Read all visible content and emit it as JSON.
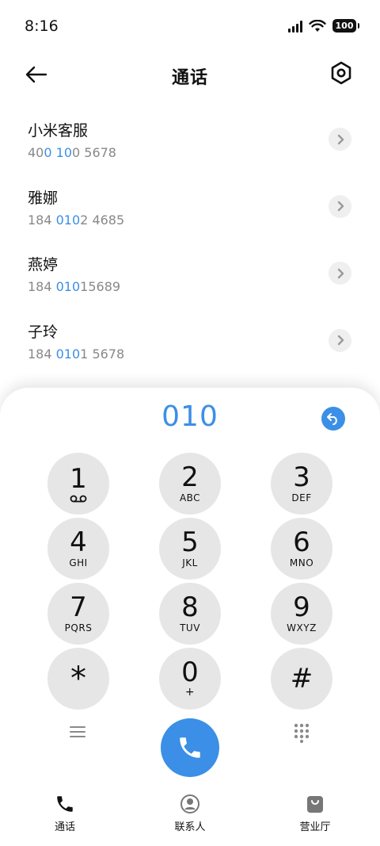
{
  "status": {
    "time": "8:16",
    "battery": "100"
  },
  "header": {
    "title": "通话",
    "back_icon": "arrow-left-icon",
    "settings_icon": "hexagon-gear-icon"
  },
  "contacts": [
    {
      "name": "小米客服",
      "number_parts": [
        "40",
        "0",
        " ",
        "10",
        "0 5678"
      ]
    },
    {
      "name": "雅娜",
      "number_parts": [
        "184 ",
        "010",
        "2 4685"
      ]
    },
    {
      "name": "燕婷",
      "number_parts": [
        "184 ",
        "010",
        "15689"
      ]
    },
    {
      "name": "子玲",
      "number_parts": [
        "184 ",
        "010",
        "1 5678"
      ]
    }
  ],
  "dial": {
    "input": "010",
    "undo_icon": "undo-arrow-icon"
  },
  "keypad": [
    {
      "digit": "1",
      "letters": ""
    },
    {
      "digit": "2",
      "letters": "ABC"
    },
    {
      "digit": "3",
      "letters": "DEF"
    },
    {
      "digit": "4",
      "letters": "GHI"
    },
    {
      "digit": "5",
      "letters": "JKL"
    },
    {
      "digit": "6",
      "letters": "MNO"
    },
    {
      "digit": "7",
      "letters": "PQRS"
    },
    {
      "digit": "8",
      "letters": "TUV"
    },
    {
      "digit": "9",
      "letters": "WXYZ"
    },
    {
      "digit": "*",
      "letters": ""
    },
    {
      "digit": "0",
      "letters": "+"
    },
    {
      "digit": "#",
      "letters": ""
    }
  ],
  "bottom_nav": [
    {
      "label": "通话",
      "icon": "phone-icon"
    },
    {
      "label": "联系人",
      "icon": "person-circle-icon"
    },
    {
      "label": "营业厅",
      "icon": "shopping-bag-icon"
    }
  ],
  "colors": {
    "accent": "#3b8fe6",
    "key_bg": "#e6e6e6"
  }
}
